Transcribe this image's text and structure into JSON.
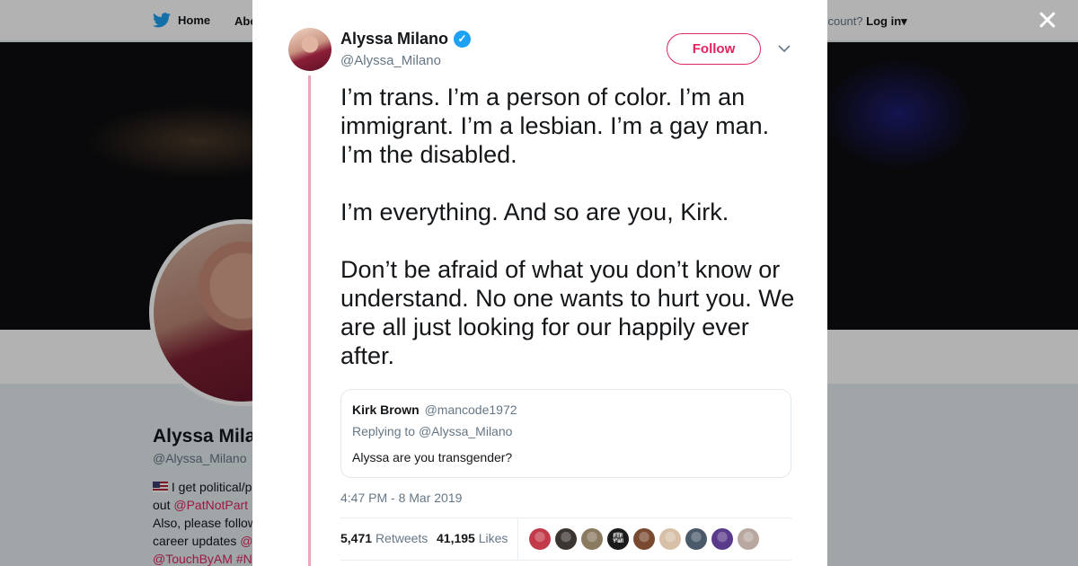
{
  "background": {
    "nav": {
      "home_label": "Home",
      "about_label": "Abo",
      "account_text": "ccount?",
      "login_label": "Log in"
    },
    "profile": {
      "name": "Alyssa Mila",
      "handle": "@Alyssa_Milano",
      "bio_lines": [
        "I get political/p",
        "out",
        "Also, please follow",
        "career updates",
        "@TouchByAM #N"
      ],
      "bio_links": [
        "@PatNotPart",
        "@",
        "@TouchByAM",
        "#N"
      ]
    }
  },
  "close_icon": "close-icon",
  "tweet": {
    "author_name": "Alyssa Milano",
    "author_handle": "@Alyssa_Milano",
    "verified": true,
    "follow_label": "Follow",
    "text": "I’m trans. I’m a person of color. I’m an immigrant. I’m a lesbian. I’m a gay man. I’m the disabled.\n\nI’m everything. And so are you, Kirk.\n\nDon’t be afraid of what you don’t know or understand. No one wants to hurt you. We are all just looking for our happily ever after.",
    "quoted": {
      "name": "Kirk Brown",
      "handle": "@mancode1972",
      "replying_prefix": "Replying to",
      "replying_to": "@Alyssa_Milano",
      "text": "Alyssa are you transgender?"
    },
    "timestamp": "4:47 PM - 8 Mar 2019",
    "retweets_count": "5,471",
    "retweets_label": "Retweets",
    "likes_count": "41,195",
    "likes_label": "Likes",
    "liker_avatars": [
      {
        "color": "#c23a4a",
        "label": ""
      },
      {
        "color": "#3a3530",
        "label": ""
      },
      {
        "color": "#8a7a60",
        "label": ""
      },
      {
        "color": "#1a1a1a",
        "label": "FTF Y'all"
      },
      {
        "color": "#7a4a30",
        "label": ""
      },
      {
        "color": "#d8c0a8",
        "label": ""
      },
      {
        "color": "#4a5a6a",
        "label": ""
      },
      {
        "color": "#5a3a8a",
        "label": ""
      },
      {
        "color": "#b8a8a0",
        "label": ""
      }
    ]
  },
  "colors": {
    "accent": "#e0245e",
    "verified": "#1da1f2",
    "thread_line": "#f2a5b8"
  }
}
